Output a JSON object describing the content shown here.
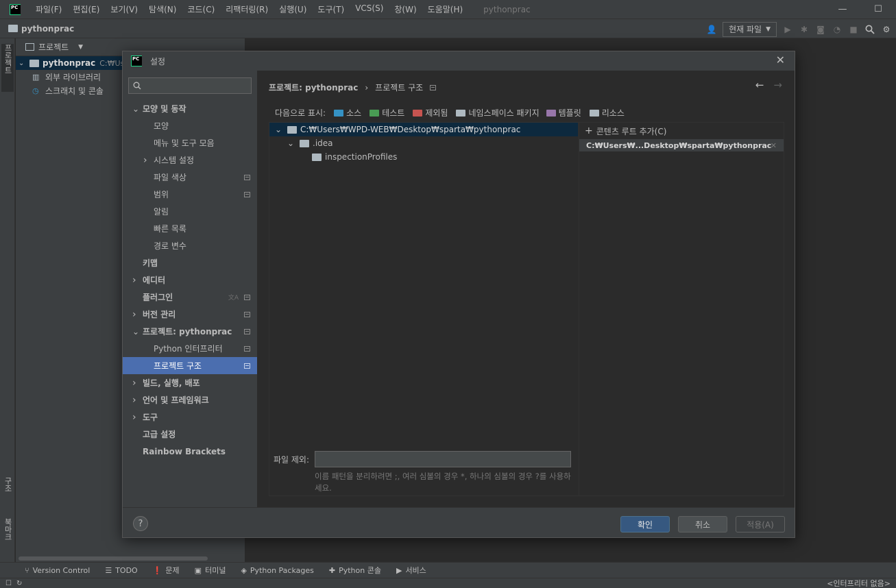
{
  "menubar": {
    "items": [
      "파일(F)",
      "편집(E)",
      "보기(V)",
      "탐색(N)",
      "코드(C)",
      "리팩터링(R)",
      "실행(U)",
      "도구(T)",
      "VCS(S)",
      "창(W)",
      "도움말(H)"
    ],
    "window_title": "pythonprac",
    "minimize": "—",
    "maximize": "☐"
  },
  "navbar": {
    "project_name": "pythonprac",
    "run_config": "현재 파일"
  },
  "stripe": {
    "project": "프로젝트",
    "structure": "구조",
    "bookmarks": "북마크"
  },
  "project_panel": {
    "header": "프로젝트",
    "tree": [
      {
        "label": "pythonprac",
        "path": "C:₩Use"
      },
      {
        "label": "외부 라이브러리"
      },
      {
        "label": "스크래치 및 콘솔"
      }
    ]
  },
  "dialog": {
    "title": "설정",
    "close": "✕",
    "search_placeholder": "",
    "sidebar": [
      {
        "label": "모양 및 동작",
        "level": 0,
        "expanded": true
      },
      {
        "label": "모양",
        "level": 1
      },
      {
        "label": "메뉴 및 도구 모음",
        "level": 1
      },
      {
        "label": "시스템 설정",
        "level": 1,
        "collapsed": true
      },
      {
        "label": "파일 색상",
        "level": 1,
        "badge": true
      },
      {
        "label": "범위",
        "level": 1,
        "badge": true
      },
      {
        "label": "알림",
        "level": 1
      },
      {
        "label": "빠른 목록",
        "level": 1
      },
      {
        "label": "경로 변수",
        "level": 1
      },
      {
        "label": "키맵",
        "level": 0
      },
      {
        "label": "에디터",
        "level": 0,
        "collapsed": true
      },
      {
        "label": "플러그인",
        "level": 0,
        "badge": true,
        "translate": true
      },
      {
        "label": "버전 관리",
        "level": 0,
        "collapsed": true,
        "badge": true
      },
      {
        "label": "프로젝트: pythonprac",
        "level": 0,
        "expanded": true,
        "badge": true
      },
      {
        "label": "Python 인터프리터",
        "level": 1,
        "badge": true
      },
      {
        "label": "프로젝트 구조",
        "level": 1,
        "badge": true,
        "selected": true
      },
      {
        "label": "빌드, 실행, 배포",
        "level": 0,
        "collapsed": true
      },
      {
        "label": "언어 및 프레임워크",
        "level": 0,
        "collapsed": true
      },
      {
        "label": "도구",
        "level": 0,
        "collapsed": true
      },
      {
        "label": "고급 설정",
        "level": 0
      },
      {
        "label": "Rainbow Brackets",
        "level": 0
      }
    ],
    "breadcrumb": {
      "parent": "프로젝트: pythonprac",
      "separator": "›",
      "current": "프로젝트 구조"
    },
    "mark_as": {
      "label": "다음으로 표시:",
      "items": [
        {
          "label": "소스",
          "color": "#3592c4"
        },
        {
          "label": "테스트",
          "color": "#499c54"
        },
        {
          "label": "제외됨",
          "color": "#c75450"
        },
        {
          "label": "네임스페이스 패키지",
          "color": "#aeb9c0"
        },
        {
          "label": "템플릿",
          "color": "#9876aa"
        },
        {
          "label": "리소스",
          "color": "#aeb9c0"
        }
      ]
    },
    "tree": [
      {
        "label": "C:₩Users₩WPD-WEB₩Desktop₩sparta₩pythonprac",
        "level": 0,
        "expanded": true,
        "selected": true
      },
      {
        "label": ".idea",
        "level": 1,
        "expanded": true
      },
      {
        "label": "inspectionProfiles",
        "level": 2
      }
    ],
    "add_root": "콘텐츠 루트 추가(C)",
    "root_path": "C:₩Users₩...Desktop₩sparta₩pythonprac",
    "exclude_label": "파일 제외:",
    "exclude_value": "",
    "hint": "이름 패턴을 분리하려면 ;, 여러 심볼의 경우 *, 하나의 심볼의 경우 ?를 사용하세요.",
    "buttons": {
      "help": "?",
      "ok": "확인",
      "cancel": "취소",
      "apply": "적용(A)"
    }
  },
  "bottom_tools": [
    {
      "label": "Version Control",
      "icon": "branch-icon"
    },
    {
      "label": "TODO",
      "icon": "list-icon"
    },
    {
      "label": "문제",
      "icon": "problems-icon"
    },
    {
      "label": "터미널",
      "icon": "terminal-icon"
    },
    {
      "label": "Python Packages",
      "icon": "packages-icon"
    },
    {
      "label": "Python 콘솔",
      "icon": "python-icon"
    },
    {
      "label": "서비스",
      "icon": "services-icon"
    }
  ],
  "status": {
    "interpreter": "<인터프리터 없음>"
  }
}
